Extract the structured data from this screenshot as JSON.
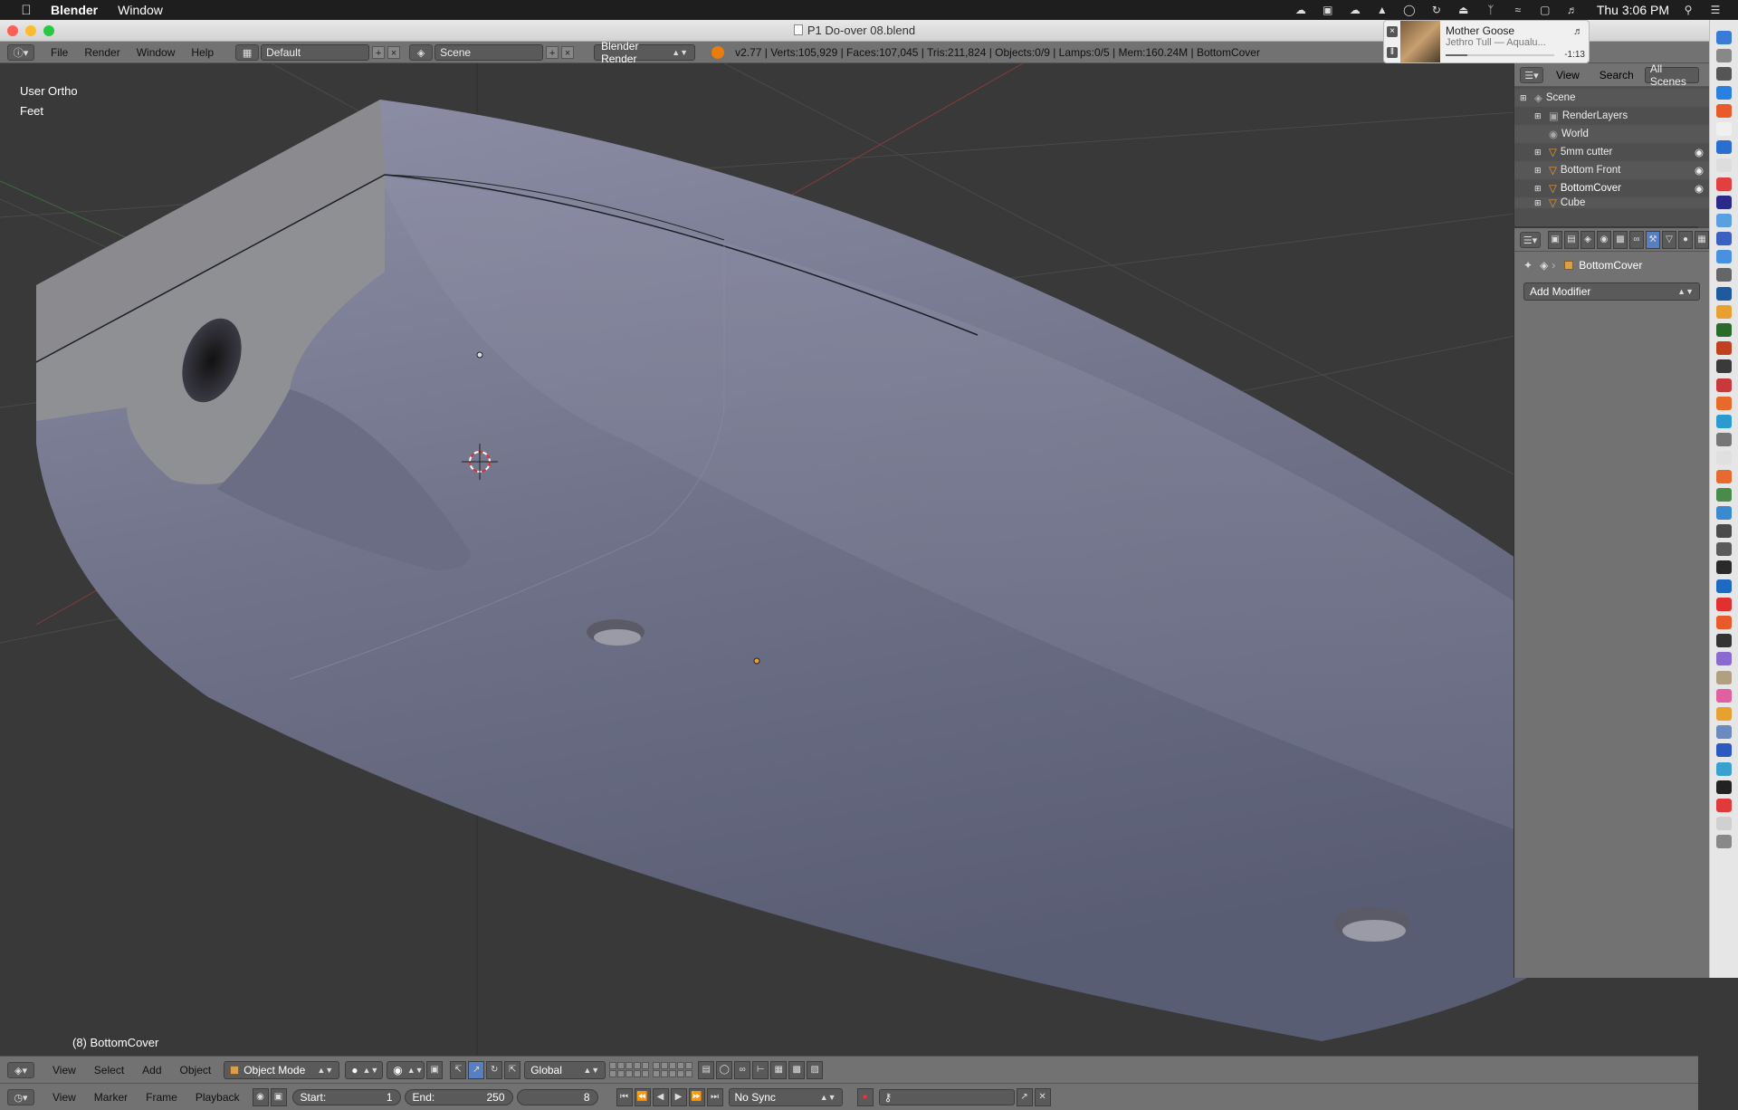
{
  "menubar": {
    "app_name": "Blender",
    "menus": [
      "Window"
    ],
    "clock": "Thu 3:06 PM"
  },
  "window": {
    "title": "P1 Do-over 08.blend"
  },
  "notification": {
    "title": "Mother Goose",
    "subtitle": "Jethro Tull — Aqualu...",
    "time": "-1:13",
    "progress": 0.2
  },
  "info_header": {
    "menus": [
      "File",
      "Render",
      "Window",
      "Help"
    ],
    "layout": "Default",
    "scene": "Scene",
    "engine": "Blender Render",
    "stats": "v2.77 | Verts:105,929 | Faces:107,045 | Tris:211,824 | Objects:0/9 | Lamps:0/5 | Mem:160.24M | BottomCover"
  },
  "viewport": {
    "view_name": "User Ortho",
    "units": "Feet",
    "active_object": "(8) BottomCover"
  },
  "view3d_header": {
    "menus": [
      "View",
      "Select",
      "Add",
      "Object"
    ],
    "mode": "Object Mode",
    "orientation": "Global"
  },
  "timeline_header": {
    "menus": [
      "View",
      "Marker",
      "Frame",
      "Playback"
    ],
    "start_label": "Start:",
    "start_value": "1",
    "end_label": "End:",
    "end_value": "250",
    "current_frame": "8",
    "sync": "No Sync"
  },
  "outliner": {
    "tabs": [
      "View",
      "Search"
    ],
    "filter": "All Scenes",
    "items": [
      {
        "label": "Scene",
        "level": 0
      },
      {
        "label": "RenderLayers",
        "level": 1
      },
      {
        "label": "World",
        "level": 1
      },
      {
        "label": "5mm cutter",
        "level": 1
      },
      {
        "label": "Bottom Front",
        "level": 1
      },
      {
        "label": "BottomCover",
        "level": 1
      },
      {
        "label": "Cube",
        "level": 1
      }
    ]
  },
  "properties": {
    "context_object": "BottomCover",
    "add_modifier": "Add Modifier"
  },
  "colors": {
    "accent_orange": "#e87d0d",
    "selected_blue": "#5680c2",
    "mesh_color": "#7c7e96"
  }
}
